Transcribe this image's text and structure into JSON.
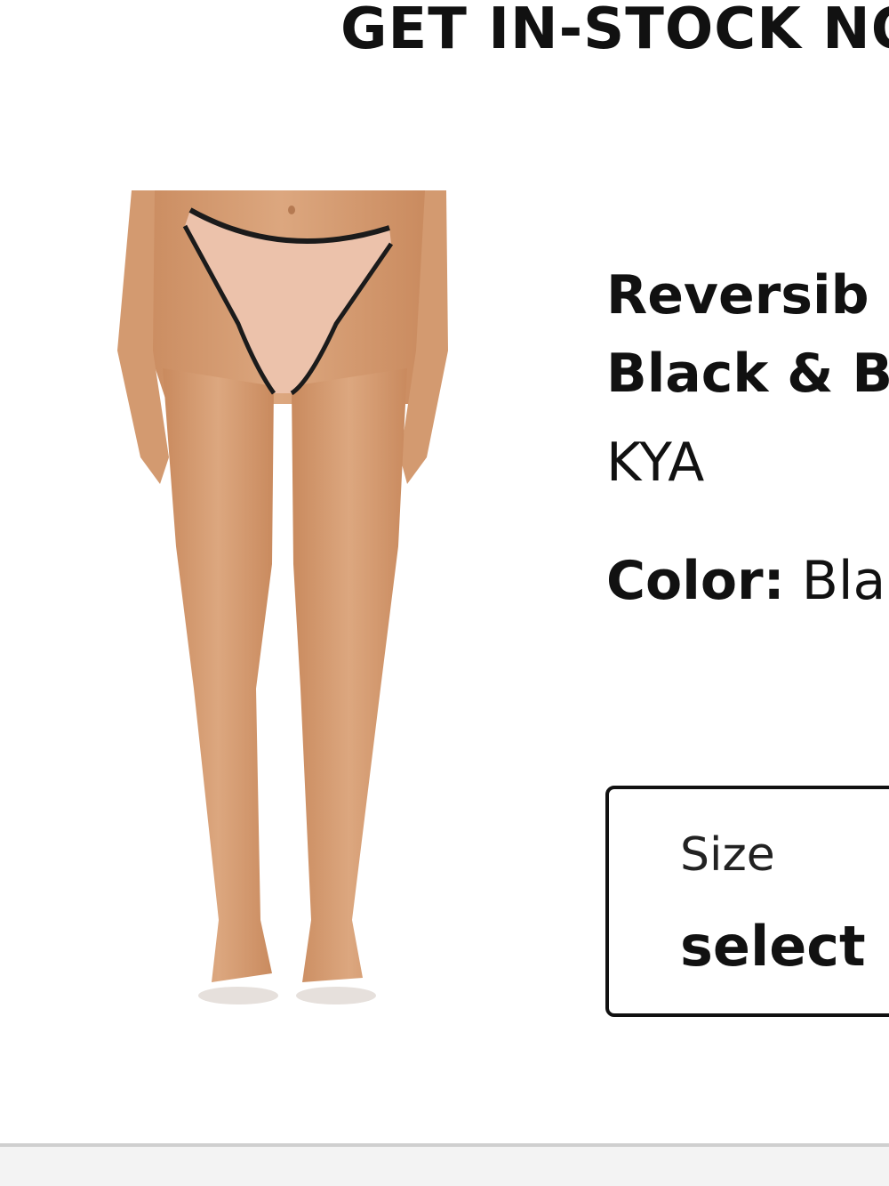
{
  "modal": {
    "title": "GET IN-STOCK NO"
  },
  "product": {
    "name_line1": "Reversib",
    "name_line2": "Black & B",
    "brand": "KYA",
    "color_label": "Color:",
    "color_value": "Bla",
    "image_alt": "Reversible bikini bottom in blush with black trim"
  },
  "size_select": {
    "label": "Size",
    "value": "select"
  }
}
